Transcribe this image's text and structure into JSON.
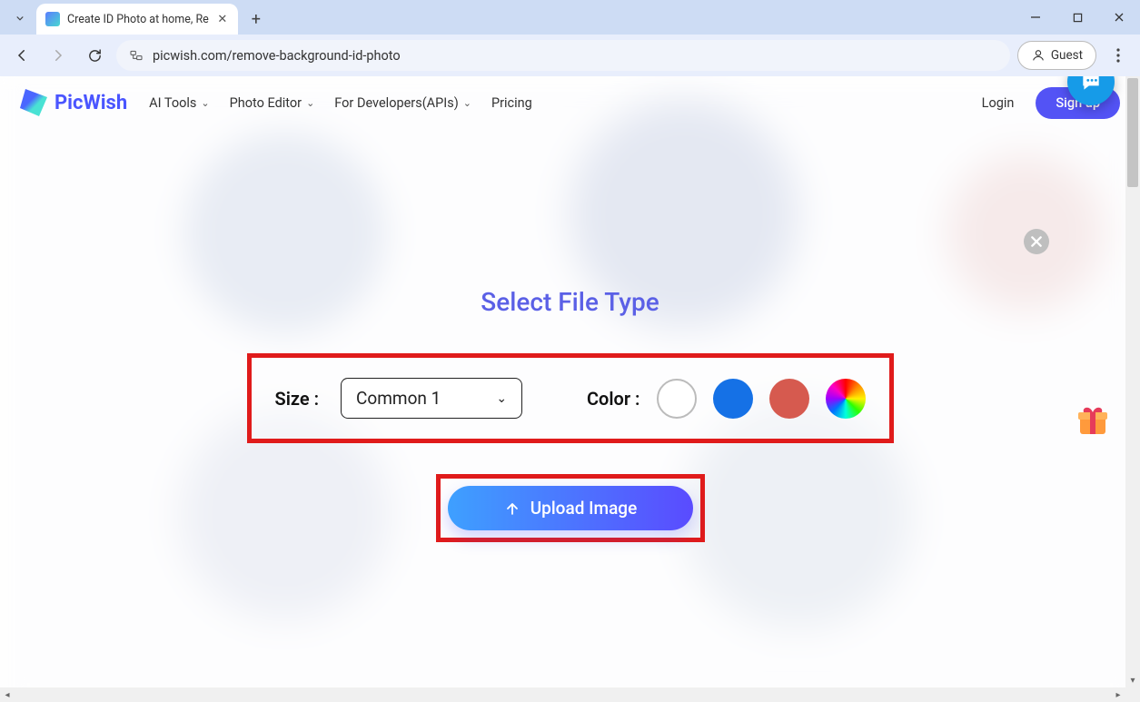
{
  "browser": {
    "tab_title": "Create ID Photo at home, Re",
    "url": "picwish.com/remove-background-id-photo",
    "guest_label": "Guest"
  },
  "header": {
    "brand": "PicWish",
    "nav": {
      "ai_tools": "AI Tools",
      "photo_editor": "Photo Editor",
      "developers": "For Developers(APIs)",
      "pricing": "Pricing"
    },
    "login": "Login",
    "signup": "Sign up"
  },
  "modal": {
    "title": "Select File Type",
    "size_label": "Size :",
    "size_value": "Common 1",
    "color_label": "Color :",
    "colors": {
      "white": "#ffffff",
      "blue": "#1571e6",
      "red": "#d65a4f",
      "rainbow": "rainbow"
    },
    "upload_label": "Upload Image"
  }
}
